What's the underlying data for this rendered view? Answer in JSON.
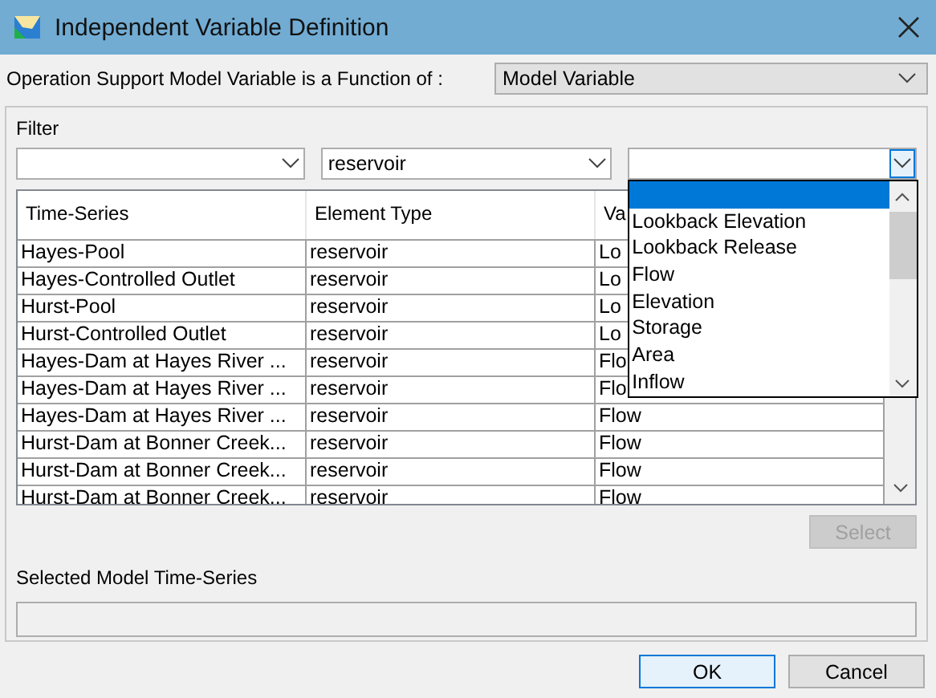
{
  "window": {
    "title": "Independent Variable Definition"
  },
  "function_of": {
    "label": "Operation Support Model Variable is a Function of :",
    "value": "Model Variable"
  },
  "filter": {
    "label": "Filter",
    "combos": [
      {
        "open": false
      },
      {
        "value": "reservoir",
        "open": false
      },
      {
        "open": true
      }
    ]
  },
  "table": {
    "columns": [
      "Time-Series",
      "Element Type",
      "Va"
    ],
    "rows": [
      [
        "Hayes-Pool",
        "reservoir",
        "Lo"
      ],
      [
        "Hayes-Controlled Outlet",
        "reservoir",
        "Lo"
      ],
      [
        "Hurst-Pool",
        "reservoir",
        "Lo"
      ],
      [
        "Hurst-Controlled Outlet",
        "reservoir",
        "Lo"
      ],
      [
        "Hayes-Dam at Hayes River ...",
        "reservoir",
        "Flo"
      ],
      [
        "Hayes-Dam at Hayes River ...",
        "reservoir",
        "Flo"
      ],
      [
        "Hayes-Dam at Hayes River ...",
        "reservoir",
        "Flow"
      ],
      [
        "Hurst-Dam at Bonner Creek...",
        "reservoir",
        "Flow"
      ],
      [
        "Hurst-Dam at Bonner Creek...",
        "reservoir",
        "Flow"
      ],
      [
        "Hurst-Dam at Bonner Creek...",
        "reservoir",
        "Flow"
      ]
    ]
  },
  "dropdown_list": {
    "items": [
      {
        "selected": true
      },
      {
        "label": "Lookback Elevation",
        "selected": false
      },
      {
        "label": "Lookback Release",
        "selected": false
      },
      {
        "label": "Flow",
        "selected": false
      },
      {
        "label": "Elevation",
        "selected": false
      },
      {
        "label": "Storage",
        "selected": false
      },
      {
        "label": "Area",
        "selected": false
      },
      {
        "label": "Inflow",
        "selected": false
      }
    ]
  },
  "select_button": {
    "label": "Select",
    "disabled": true
  },
  "selected_series": {
    "label": "Selected Model Time-Series"
  },
  "buttons": [
    {
      "label": "OK",
      "default": true
    },
    {
      "label": "Cancel",
      "default": false
    }
  ]
}
